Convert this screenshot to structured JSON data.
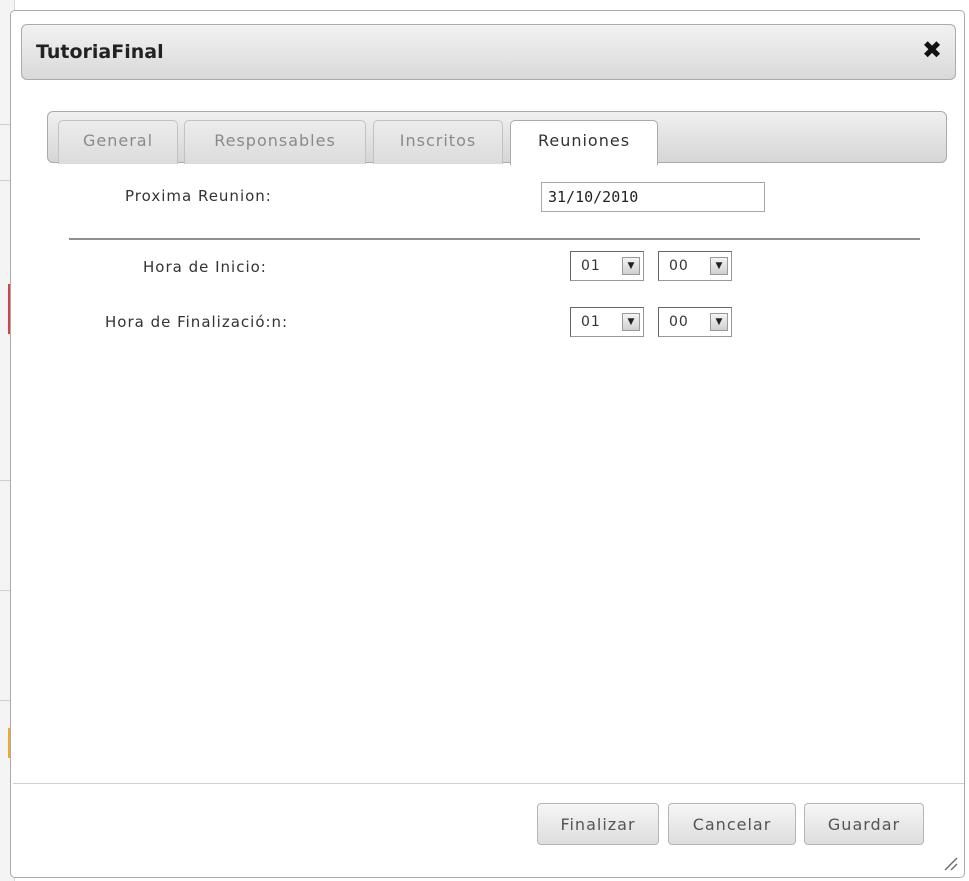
{
  "dialog": {
    "title": "TutoriaFinal",
    "close_glyph": "✖"
  },
  "tabs": [
    {
      "label": "General",
      "active": false
    },
    {
      "label": "Responsables",
      "active": false
    },
    {
      "label": "Inscritos",
      "active": false
    },
    {
      "label": "Reuniones",
      "active": true
    }
  ],
  "form": {
    "next_meeting_label": "Proxima Reunion:",
    "next_meeting_value": "31/10/2010",
    "start_time_label": "Hora de Inicio:",
    "start_hour": "01",
    "start_minute": "00",
    "end_time_label": "Hora de Finalizació:n:",
    "end_hour": "01",
    "end_minute": "00",
    "dropdown_arrow": "▼"
  },
  "buttons": {
    "finalize": "Finalizar",
    "cancel": "Cancelar",
    "save": "Guardar"
  },
  "colors": {
    "left_marker_red": "#d0454a",
    "left_marker_orange": "#f0a830"
  }
}
